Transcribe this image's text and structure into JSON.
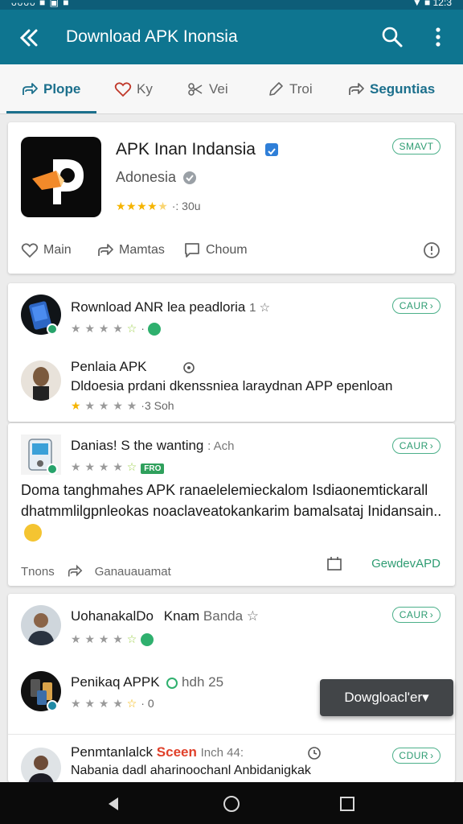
{
  "statusbar": {
    "left": "ᴗᴗᴗᴗ ■ ▣ ■",
    "right": "▼ ■ 12:3"
  },
  "appbar": {
    "title": "Download APK Inonsia"
  },
  "tabs": [
    {
      "label": "Plope"
    },
    {
      "label": "Ky"
    },
    {
      "label": "Vei"
    },
    {
      "label": "Troi"
    },
    {
      "label": "Seguntias"
    }
  ],
  "featured": {
    "name": "APK Inan Indansia",
    "publisher": "Adonesia",
    "rating_text": "·: 30u",
    "stars_full": 4,
    "install_label": "SMAVT",
    "actions": {
      "like": "Main",
      "share": "Mamtas",
      "comment": "Choum"
    }
  },
  "list1": [
    {
      "title": "Rownload ANR lea peadloria",
      "suffix": "1 ☆",
      "meta": "·",
      "install": "CAUR"
    },
    {
      "title": "Penlaia APK",
      "desc": "Dldoesia prdani dkenssniea laraydnan APP epenloan",
      "meta": "·3 Soh"
    }
  ],
  "post": {
    "title": "Danias! S the wanting",
    "title_suffix": ": Ach",
    "badge": "FRO",
    "install": "CAUR",
    "body": "Doma tanghmahes APK ranaelelemieckalom Isdiaonemtickarall dhatmmlilgpnleokas noaclaveatokankarim bamalsataj Inidansain..",
    "footer_left": "Tnons",
    "footer_mid": "Ganauauamat",
    "footer_right": "GewdevAPD"
  },
  "list2": [
    {
      "title": "UohanakalDo",
      "title2": "Knam",
      "title3": "Banda ☆",
      "install": "CAUR"
    },
    {
      "title": "Penikaq APPK",
      "suffix": "hdh 25",
      "meta": "· 0"
    },
    {
      "title": "Penmtanlalck",
      "hot": "Sceen",
      "suffix": "Inch 44:",
      "desc": "Nabania dadl aharinoochanl Anbidanigkak",
      "install": "CDUR"
    }
  ],
  "fab": {
    "label": "Dowgloacl'er▾"
  }
}
